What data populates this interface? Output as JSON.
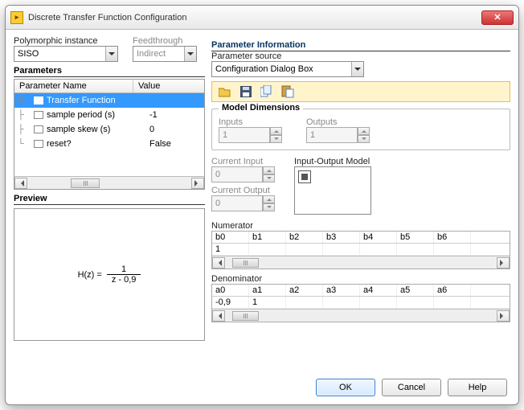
{
  "window": {
    "title": "Discrete Transfer Function Configuration"
  },
  "left": {
    "poly_label": "Polymorphic instance",
    "poly_value": "SISO",
    "feed_label": "Feedthrough",
    "feed_value": "Indirect",
    "params_title": "Parameters",
    "col_name": "Parameter Name",
    "col_value": "Value",
    "rows": [
      {
        "name": "Transfer Function",
        "value": ""
      },
      {
        "name": "sample period (s)",
        "value": "-1"
      },
      {
        "name": "sample skew (s)",
        "value": "0"
      },
      {
        "name": "reset?",
        "value": "False"
      }
    ],
    "preview_title": "Preview",
    "formula_left": "H(z) =",
    "formula_num": "1",
    "formula_den": "z - 0,9"
  },
  "right": {
    "title": "Parameter Information",
    "source_label": "Parameter source",
    "source_value": "Configuration Dialog Box",
    "model_dims_title": "Model Dimensions",
    "inputs_label": "Inputs",
    "inputs_value": "1",
    "outputs_label": "Outputs",
    "outputs_value": "1",
    "cur_in_label": "Current Input",
    "cur_in_value": "0",
    "cur_out_label": "Current Output",
    "cur_out_value": "0",
    "iom_label": "Input-Output Model",
    "numerator_label": "Numerator",
    "num_headers": [
      "b0",
      "b1",
      "b2",
      "b3",
      "b4",
      "b5",
      "b6"
    ],
    "num_values": [
      "1",
      "",
      "",
      "",
      "",
      "",
      ""
    ],
    "denominator_label": "Denominator",
    "den_headers": [
      "a0",
      "a1",
      "a2",
      "a3",
      "a4",
      "a5",
      "a6"
    ],
    "den_values": [
      "-0,9",
      "1",
      "",
      "",
      "",
      "",
      ""
    ]
  },
  "footer": {
    "ok": "OK",
    "cancel": "Cancel",
    "help": "Help"
  }
}
